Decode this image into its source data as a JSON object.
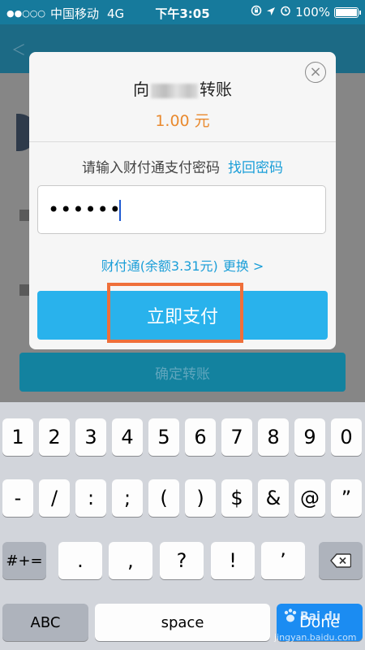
{
  "status_bar": {
    "signal_dots": "●●○○○",
    "carrier": "中国移动",
    "network": "4G",
    "time": "下午3:05",
    "battery_pct": "100%",
    "battery_level": 1.0,
    "lock_icon": "rotation-lock-icon",
    "location_icon": "location-arrow-icon",
    "alarm_icon": "alarm-clock-icon"
  },
  "background": {
    "back_label": "＜",
    "title": "",
    "confirm_button": "确定转账"
  },
  "dialog": {
    "recipient_prefix": "向",
    "recipient_suffix": "转账",
    "amount": "1.00 元",
    "prompt": "请输入财付通支付密码",
    "forgot_link": "找回密码",
    "password_mask": "••••••",
    "balance_text": "财付通(余额3.31元)",
    "change_link": "更换 >",
    "pay_button": "立即支付",
    "close_icon": "close-icon",
    "highlight_color": "#ef6f3a",
    "accent_color": "#29b2ec",
    "amount_color": "#e98a2f"
  },
  "keyboard": {
    "row1": [
      "1",
      "2",
      "3",
      "4",
      "5",
      "6",
      "7",
      "8",
      "9",
      "0"
    ],
    "row2": [
      "-",
      "/",
      ":",
      ";",
      "(",
      ")",
      "$",
      "&",
      "@",
      "”"
    ],
    "row3_left": "#+=",
    "row3": [
      ".",
      ",",
      "?",
      "!",
      "’"
    ],
    "row3_backspace_icon": "backspace-icon",
    "row4_abc": "ABC",
    "row4_space": "space",
    "row4_done": "Done"
  },
  "watermark": {
    "logo": "Bai du",
    "url": "jingyan.baidu.com"
  }
}
